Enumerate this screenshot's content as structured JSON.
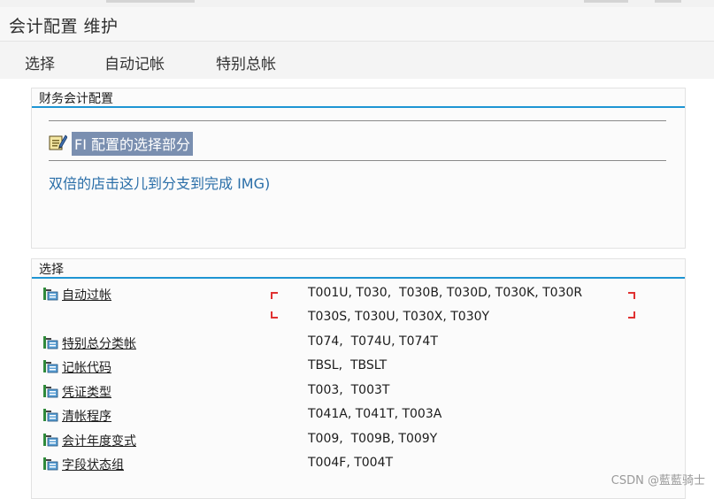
{
  "window": {
    "title": "会计配置 维护"
  },
  "menu": {
    "items": [
      {
        "label": "选择"
      },
      {
        "label": "自动记帐"
      },
      {
        "label": "特别总帐"
      }
    ]
  },
  "finance_group": {
    "title": "财务会计配置",
    "fi_link": "FI 配置的选择部分",
    "double_click_link": "双倍的店击这儿到分支到完成 IMG)"
  },
  "selection_group": {
    "title": "选择",
    "rows": [
      {
        "label": "自动过帐",
        "tables": [
          "T001U, T030,  T030B, T030D, T030K, T030R",
          "T030S, T030U, T030X, T030Y"
        ]
      },
      {
        "label": "特别总分类帐",
        "tables": [
          "T074,  T074U, T074T"
        ]
      },
      {
        "label": "记帐代码",
        "tables": [
          "TBSL,  TBSLT"
        ]
      },
      {
        "label": "凭证类型",
        "tables": [
          "T003,  T003T"
        ]
      },
      {
        "label": "清帐程序",
        "tables": [
          "T041A, T041T, T003A"
        ]
      },
      {
        "label": "会计年度变式",
        "tables": [
          "T009,  T009B, T009Y"
        ]
      },
      {
        "label": "字段状态组",
        "tables": [
          "T004F, T004T"
        ]
      }
    ]
  },
  "watermark": "CSDN @藍藍骑士",
  "colors": {
    "accent": "#1e95d3",
    "link": "#2a6ea8",
    "selection_highlight": "#7a8fb0",
    "focus_corner": "#e03131"
  },
  "icons": {
    "fi": "edit-config-icon",
    "tree": "tree-node-icon"
  }
}
